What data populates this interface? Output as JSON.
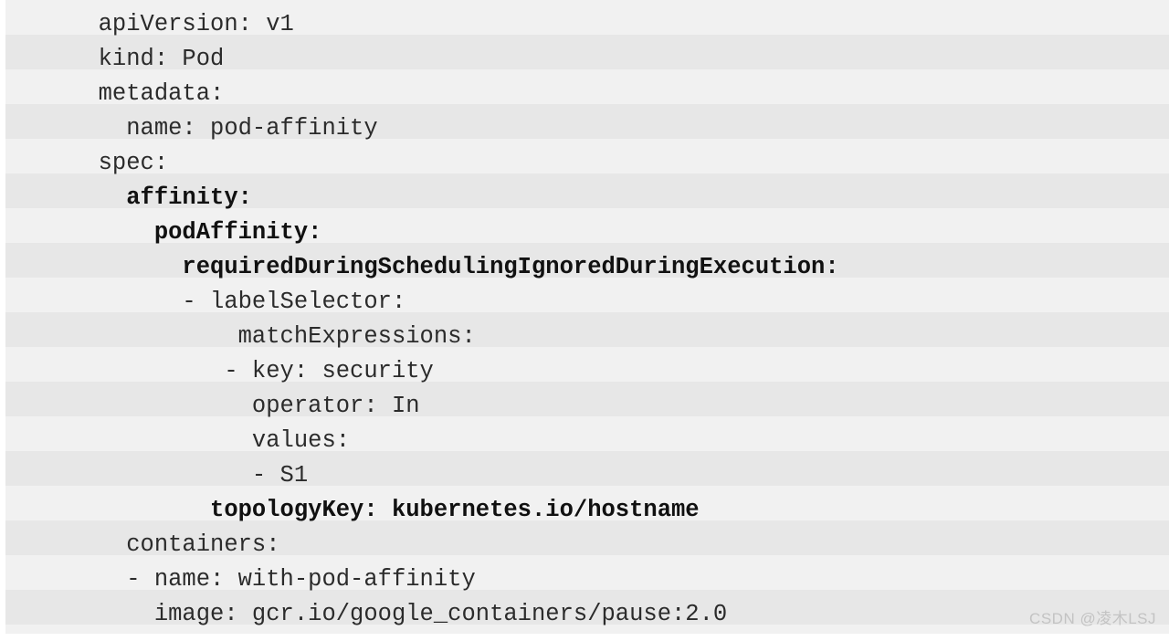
{
  "code_block": {
    "language": "yaml",
    "background_color": "#e7e7e7",
    "text_color": "#2b2b2b",
    "stripe_highlight_color": "#ededed",
    "lines": [
      {
        "text": "  apiVersion: v1",
        "bold": false
      },
      {
        "text": "  kind: Pod",
        "bold": false
      },
      {
        "text": "  metadata:",
        "bold": false
      },
      {
        "text": "    name: pod-affinity",
        "bold": false
      },
      {
        "text": "  spec:",
        "bold": false
      },
      {
        "text": "    affinity:",
        "bold": true
      },
      {
        "text": "      podAffinity:",
        "bold": true
      },
      {
        "text": "        requiredDuringSchedulingIgnoredDuringExecution:",
        "bold": true
      },
      {
        "text": "        - labelSelector:",
        "bold": false
      },
      {
        "text": "            matchExpressions:",
        "bold": false
      },
      {
        "text": "           - key: security",
        "bold": false
      },
      {
        "text": "             operator: In",
        "bold": false
      },
      {
        "text": "             values:",
        "bold": false
      },
      {
        "text": "             - S1",
        "bold": false
      },
      {
        "text": "          topologyKey: kubernetes.io/hostname",
        "bold": true
      },
      {
        "text": "    containers:",
        "bold": false
      },
      {
        "text": "    - name: with-pod-affinity",
        "bold": false
      },
      {
        "text": "      image: gcr.io/google_containers/pause:2.0",
        "bold": false
      }
    ]
  },
  "watermark": {
    "text": "CSDN @凌木LSJ",
    "color": "#c3c3c3"
  }
}
